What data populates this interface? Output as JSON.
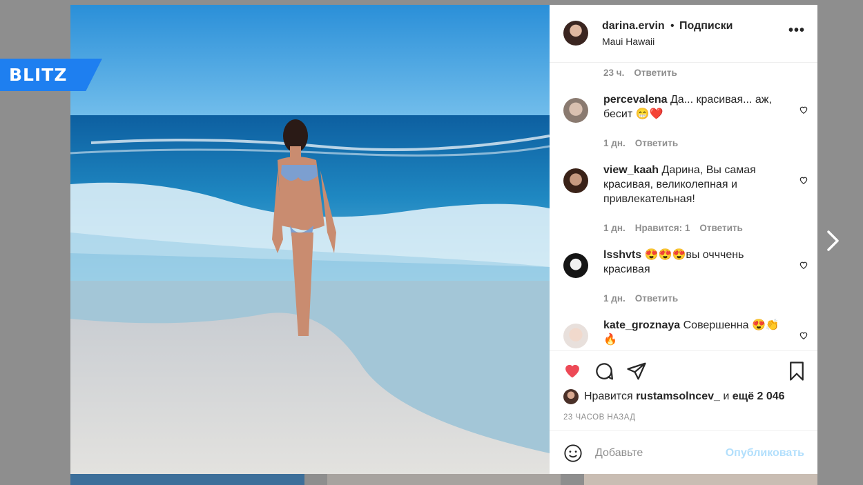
{
  "brand": {
    "logo_text": "BLITZ",
    "color": "#1e7ff0"
  },
  "post": {
    "username": "darina.ervin",
    "separator": "•",
    "follow_label": "Подписки",
    "location": "Maui Hawaii",
    "more_icon": "more-horizontal-icon"
  },
  "comments": {
    "top_meta": {
      "time": "23 ч.",
      "reply": "Ответить"
    },
    "items": [
      {
        "user": "percevalena",
        "text": "Да... красивая... аж, бесит 😁❤️",
        "time": "1 дн.",
        "likes": "",
        "reply": "Ответить"
      },
      {
        "user": "view_kaah",
        "text": "Дарина, Вы самая красивая, великолепная и привлекательная!",
        "time": "1 дн.",
        "likes": "Нравится: 1",
        "reply": "Ответить"
      },
      {
        "user": "lsshvts",
        "text": "😍😍😍вы очччень красивая",
        "time": "1 дн.",
        "likes": "",
        "reply": "Ответить"
      },
      {
        "user": "kate_groznaya",
        "text": "Совершенна 😍👏🔥",
        "time": "",
        "likes": "",
        "reply": ""
      }
    ]
  },
  "actions": {
    "like_icon": "heart-filled-icon",
    "comment_icon": "comment-icon",
    "share_icon": "send-icon",
    "save_icon": "bookmark-icon",
    "like_color": "#ed4956"
  },
  "likes": {
    "prefix": "Нравится",
    "user": "rustamsolncev_",
    "middle": "и",
    "rest": "ещё 2 046"
  },
  "timestamp": "23 ЧАСОВ НАЗАД",
  "add_comment": {
    "placeholder": "Добавьте",
    "publish": "Опубликовать",
    "emoji_icon": "smiley-icon"
  }
}
